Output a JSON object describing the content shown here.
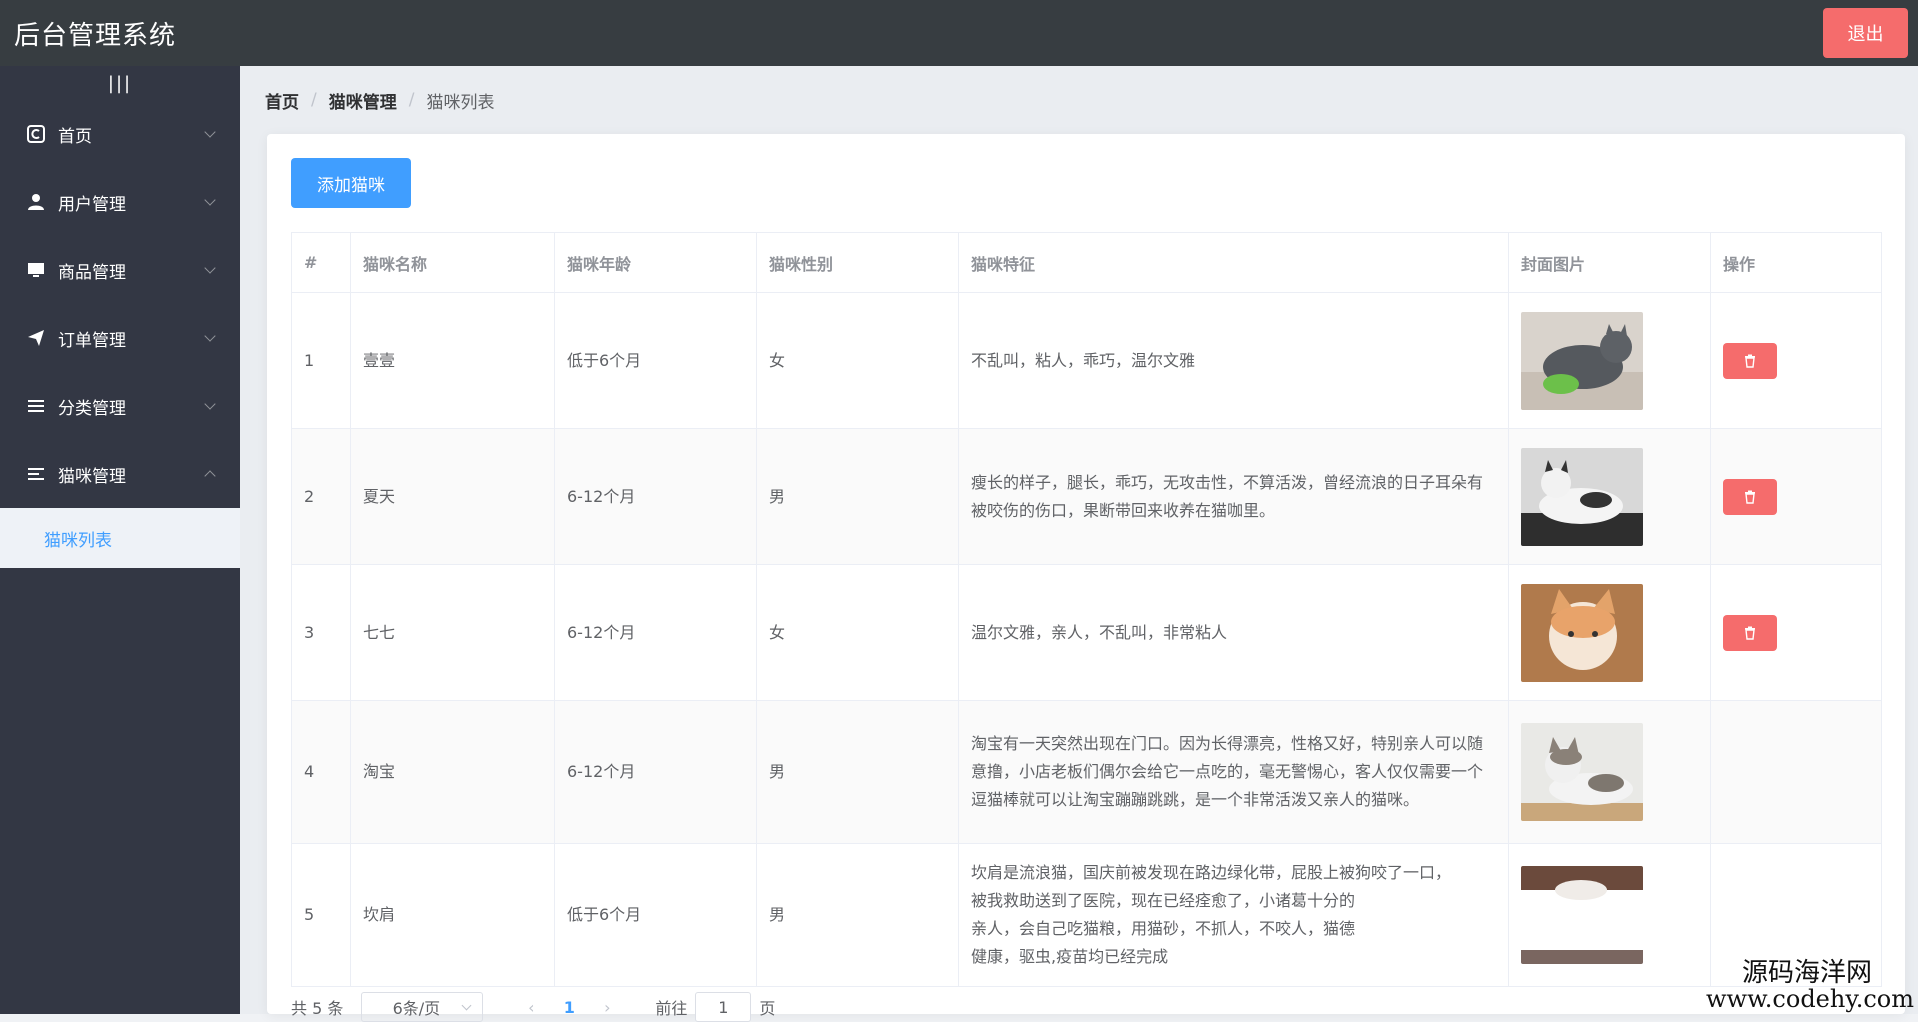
{
  "header": {
    "title": "后台管理系统",
    "logout_label": "退出"
  },
  "sidebar": {
    "toggle": "|||",
    "items": [
      {
        "label": "首页",
        "icon": "home-icon",
        "expanded": false
      },
      {
        "label": "用户管理",
        "icon": "user-icon",
        "expanded": false
      },
      {
        "label": "商品管理",
        "icon": "monitor-icon",
        "expanded": false
      },
      {
        "label": "订单管理",
        "icon": "send-icon",
        "expanded": false
      },
      {
        "label": "分类管理",
        "icon": "list-icon",
        "expanded": false
      },
      {
        "label": "猫咪管理",
        "icon": "list-icon",
        "expanded": true
      }
    ],
    "submenu": {
      "label": "猫咪列表",
      "active": true
    }
  },
  "breadcrumb": {
    "home": "首页",
    "parent": "猫咪管理",
    "current": "猫咪列表",
    "sep": "/"
  },
  "toolbar": {
    "add_label": "添加猫咪"
  },
  "table": {
    "headers": [
      "#",
      "猫咪名称",
      "猫咪年龄",
      "猫咪性别",
      "猫咪特征",
      "封面图片",
      "操作"
    ],
    "rows": [
      {
        "index": "1",
        "name": "壹壹",
        "age": "低于6个月",
        "gender": "女",
        "features": "不乱叫，粘人，乖巧，温尔文雅",
        "photo": "gray cat lying with toy"
      },
      {
        "index": "2",
        "name": "夏天",
        "age": "6-12个月",
        "gender": "男",
        "features": "瘦长的样子，腿长，乖巧，无攻击性，不算活泼，曾经流浪的日子耳朵有被咬伤的伤口，果断带回来收养在猫咖里。",
        "photo": "black and white cat lying"
      },
      {
        "index": "3",
        "name": "七七",
        "age": "6-12个月",
        "gender": "女",
        "features": "温尔文雅，亲人，不乱叫，非常粘人",
        "photo": "orange white cat looking up"
      },
      {
        "index": "4",
        "name": "淘宝",
        "age": "6-12个月",
        "gender": "男",
        "features": "淘宝有一天突然出现在门口。因为长得漂亮，性格又好，特别亲人可以随意撸，小店老板们偶尔会给它一点吃的，毫无警惕心，客人仅仅需要一个逗猫棒就可以让淘宝蹦蹦跳跳，是一个非常活泼又亲人的猫咪。",
        "photo": "tabby white cat lying"
      },
      {
        "index": "5",
        "name": "坎肩",
        "age": "低于6个月",
        "gender": "男",
        "features_lines": [
          "坎肩是流浪猫，国庆前被发现在路边绿化带，屁股上被狗咬了一口，",
          "被我救助送到了医院，现在已经痊愈了，小诸葛十分的",
          "亲人，会自己吃猫粮，用猫砂，不抓人，不咬人，猫德",
          "健康，驱虫,疫苗均已经完成"
        ],
        "photo": "white cat partially visible"
      }
    ]
  },
  "pagination": {
    "total": "共 5 条",
    "page_size": "6条/页",
    "prev": "‹",
    "current_page": "1",
    "next": "›",
    "goto_prefix": "前往",
    "goto_value": "1",
    "goto_suffix": "页"
  },
  "watermark": {
    "line1": "源码海洋网",
    "line2": "www.codehy.com"
  },
  "colors": {
    "header_bg": "#373d41",
    "sidebar_bg": "#333744",
    "primary": "#409eff",
    "danger": "#f56c6c"
  }
}
